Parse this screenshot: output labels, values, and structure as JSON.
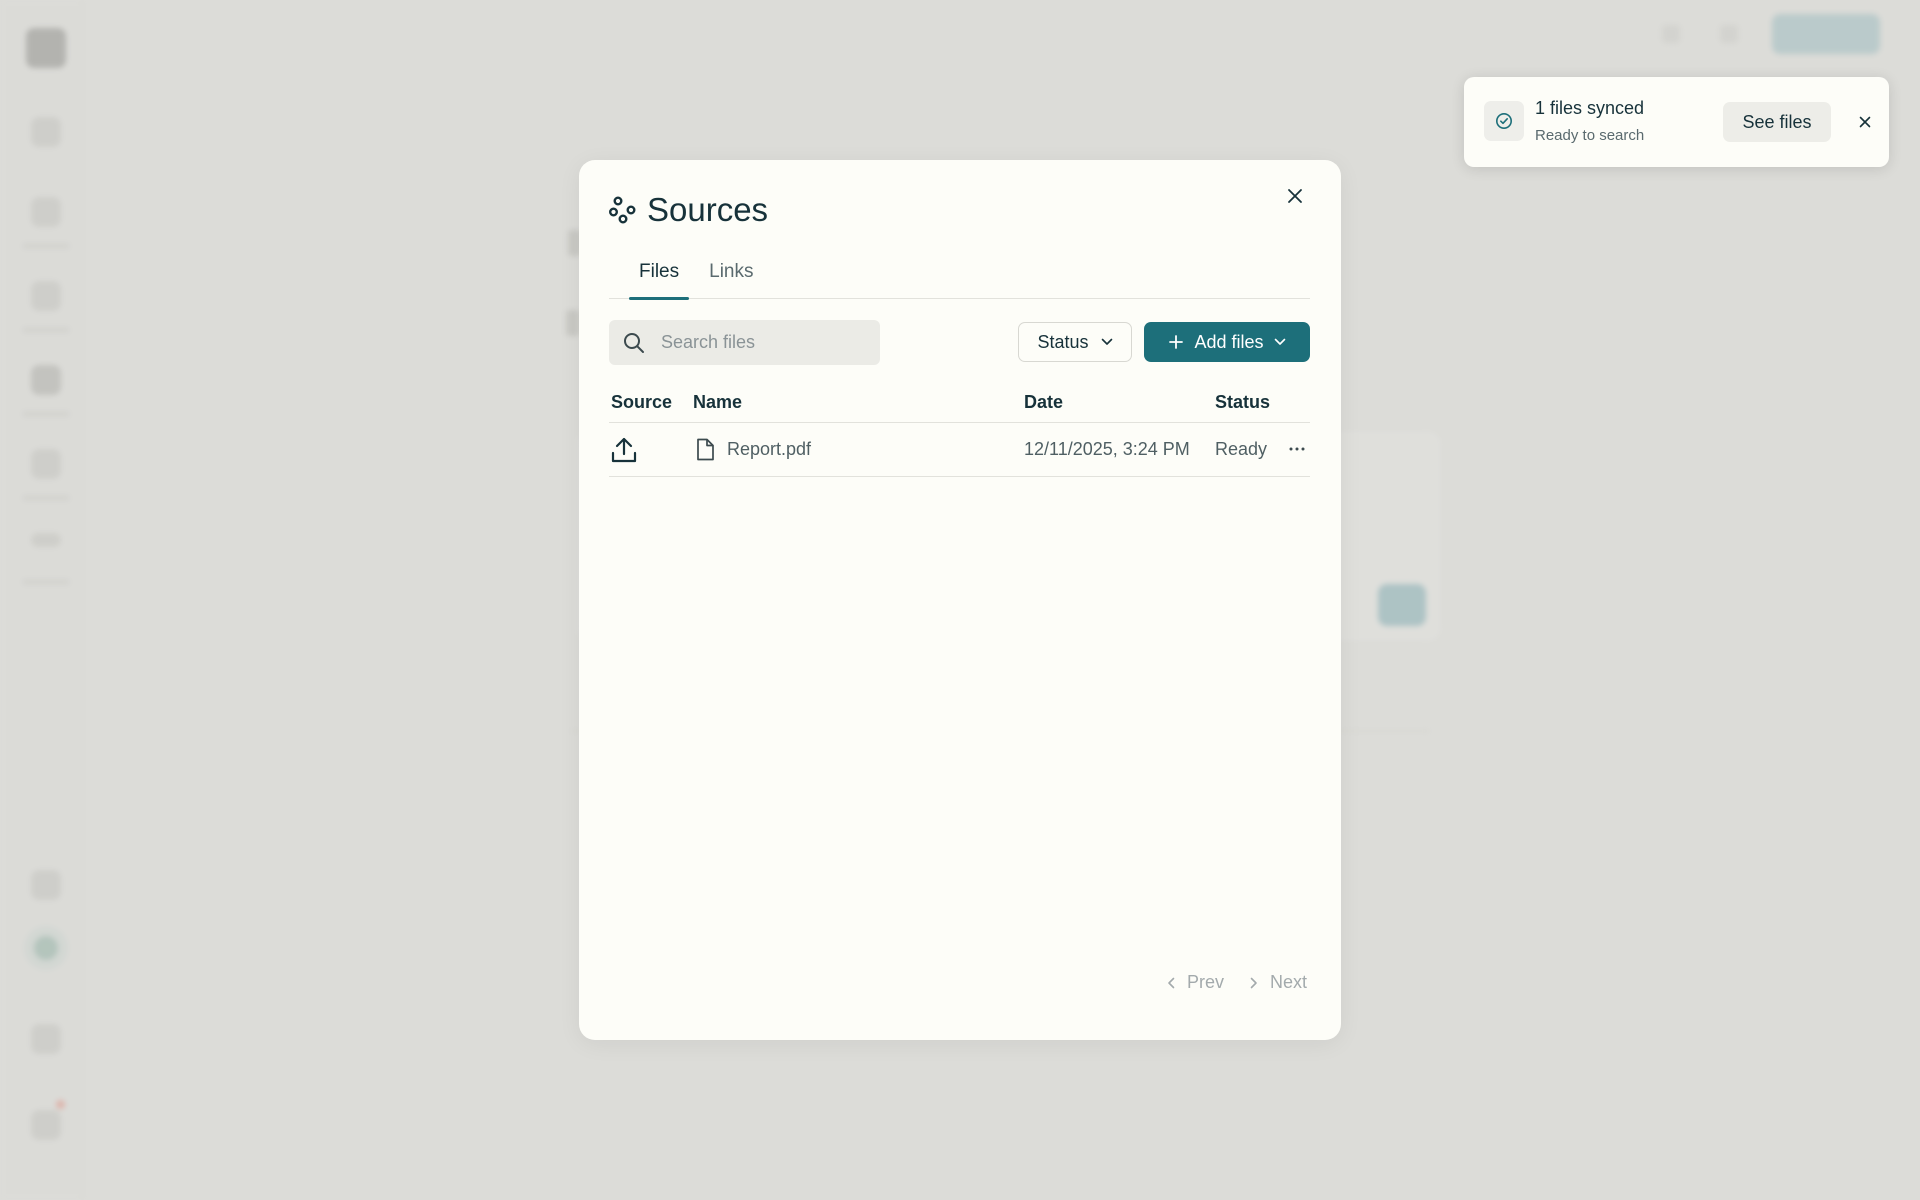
{
  "modal": {
    "title": "Sources",
    "tabs": [
      {
        "label": "Files",
        "active": true
      },
      {
        "label": "Links",
        "active": false
      }
    ],
    "search": {
      "placeholder": "Search files",
      "value": ""
    },
    "status_filter_label": "Status",
    "add_files_label": "Add files",
    "table": {
      "columns": [
        "Source",
        "Name",
        "Date",
        "Status"
      ],
      "rows": [
        {
          "source_icon": "upload-icon",
          "name": "Report.pdf",
          "date": "12/11/2025, 3:24 PM",
          "status": "Ready"
        }
      ]
    },
    "pagination": {
      "prev_label": "Prev",
      "next_label": "Next"
    }
  },
  "toast": {
    "title": "1 files synced",
    "subtitle": "Ready to search",
    "action_label": "See files"
  },
  "colors": {
    "accent": "#1d6f7a",
    "text": "#17323a"
  }
}
